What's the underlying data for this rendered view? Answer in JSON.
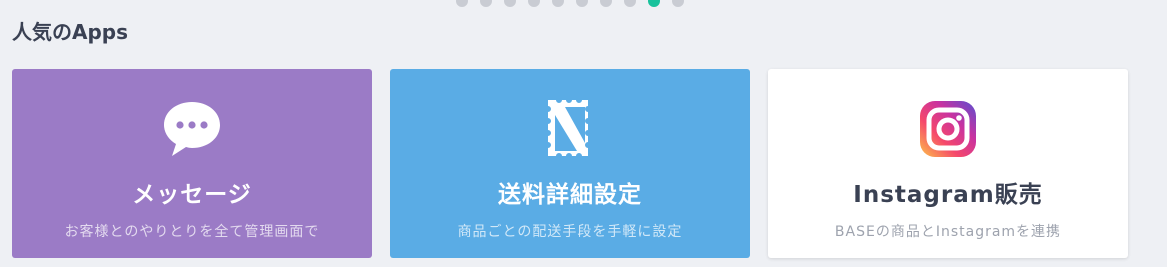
{
  "carousel": {
    "dot_count": 10,
    "active_index": 8,
    "accent_color": "#18c29c"
  },
  "section": {
    "title": "人気のApps"
  },
  "cards": [
    {
      "icon": "chat-bubble-icon",
      "title": "メッセージ",
      "description": "お客様とのやりとりを全て管理画面で",
      "color": "#9b7bc6"
    },
    {
      "icon": "shipping-stamp-icon",
      "title": "送料詳細設定",
      "description": "商品ごとの配送手段を手軽に設定",
      "color": "#5aace5"
    },
    {
      "icon": "instagram-icon",
      "title": "Instagram販売",
      "description": "BASEの商品とInstagramを連携",
      "color": "#ffffff"
    }
  ]
}
